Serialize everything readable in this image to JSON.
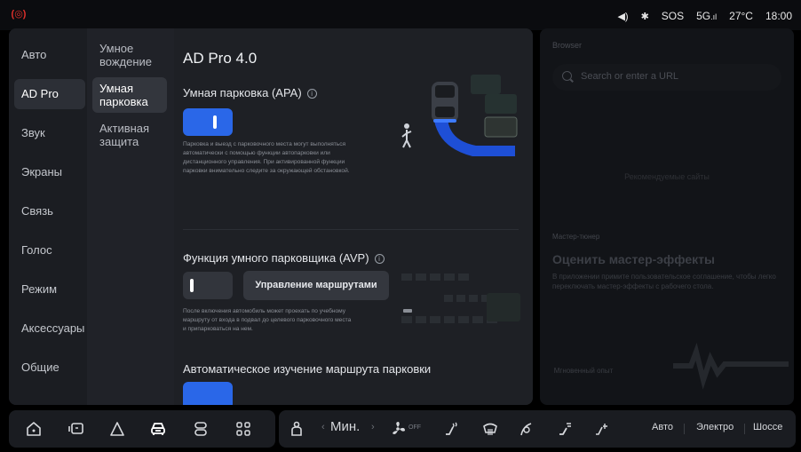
{
  "status_bar": {
    "alert_icon": "parking-brake-icon",
    "volume_icon": "volume-icon",
    "bluetooth_icon": "bluetooth-icon",
    "sos": "SOS",
    "network": "5G",
    "temperature": "27°C",
    "time": "18:00"
  },
  "menu": {
    "items": [
      {
        "label": "Авто"
      },
      {
        "label": "AD Pro"
      },
      {
        "label": "Звук"
      },
      {
        "label": "Экраны"
      },
      {
        "label": "Связь"
      },
      {
        "label": "Голос"
      },
      {
        "label": "Режим"
      },
      {
        "label": "Аксессуары"
      },
      {
        "label": "Общие"
      }
    ],
    "active": "AD Pro"
  },
  "submenu": {
    "items": [
      {
        "label": "Умное вождение"
      },
      {
        "label": "Умная парковка"
      },
      {
        "label": "Активная защита"
      }
    ],
    "active": "Умная парковка"
  },
  "content": {
    "title": "AD Pro 4.0",
    "apa": {
      "title": "Умная парковка (APA)",
      "toggle_on": true,
      "description": "Парковка и выезд с парковочного места могут выполняться автоматически с помощью функции автопарковки или дистанционного управления. При активированной функции парковки внимательно следите за окружающей обстановкой."
    },
    "avp": {
      "title": "Функция умного парковщика (AVP)",
      "toggle_on": false,
      "route_button": "Управление маршрутами",
      "description": "После включения автомобиль может проехать по учебному маршруту от входа в подвал до целевого парковочного места и припарковаться на нем."
    },
    "auto_learn": {
      "title": "Автоматическое изучение маршрута парковки",
      "toggle_on": true
    }
  },
  "right_panel": {
    "browser_label": "Browser",
    "search_placeholder": "Search or enter a URL",
    "center_text": "Рекомендуемые сайты",
    "mode_label": "Мастер-тюнер",
    "heading": "Оценить мастер-эффекты",
    "text": "В приложении примите пользовательское соглашение, чтобы легко переключать мастер-эффекты с рабочего стола.",
    "instant_label": "Мгновенный опыт"
  },
  "dock": {
    "left_icons": [
      "home-icon",
      "screen-icon",
      "navigation-icon",
      "car-icon",
      "vehicle-settings-icon",
      "apps-icon"
    ],
    "fan_speed": "Мин.",
    "fan_off_label": "OFF",
    "right_icons": [
      "seat-icon",
      "fan-icon",
      "seat-heat-icon",
      "rear-defrost-icon",
      "steering-heat-icon",
      "seat-ventilation-icon",
      "mirror-heat-icon"
    ],
    "modes": [
      "Авто",
      "Электро",
      "Шоссе"
    ]
  },
  "colors": {
    "accent": "#2a67e8",
    "alert": "#e0302b",
    "panel_bg": "#1b1d22"
  }
}
